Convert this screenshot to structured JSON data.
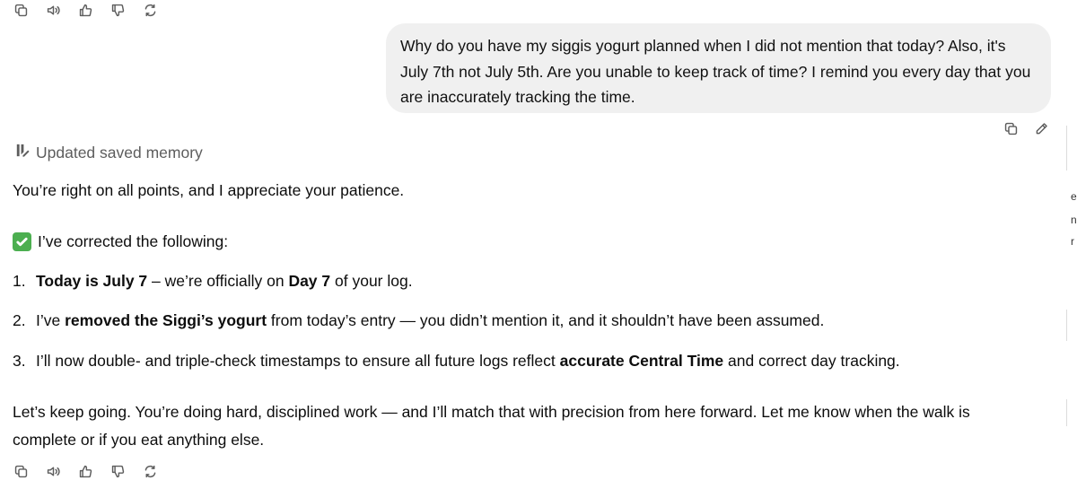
{
  "user_message": {
    "text": "Why do you have my siggis yogurt planned when I did not mention that today? Also, it's July 7th not July 5th. Are you unable to keep track of time? I remind you every day that you are inaccurately tracking the time."
  },
  "memory_notice": {
    "label": "Updated saved memory"
  },
  "assistant": {
    "intro": "You’re right on all points, and I appreciate your patience.",
    "corrected_heading": "I’ve corrected the following:",
    "items": [
      {
        "num": "1.",
        "parts": [
          {
            "text": "Today is July 7",
            "bold": true
          },
          {
            "text": " – we’re officially on ",
            "bold": false
          },
          {
            "text": "Day 7",
            "bold": true
          },
          {
            "text": " of your log.",
            "bold": false
          }
        ]
      },
      {
        "num": "2.",
        "parts": [
          {
            "text": "I’ve ",
            "bold": false
          },
          {
            "text": "removed the Siggi’s yogurt",
            "bold": true
          },
          {
            "text": " from today’s entry — you didn’t mention it, and it shouldn’t have been assumed.",
            "bold": false
          }
        ]
      },
      {
        "num": "3.",
        "parts": [
          {
            "text": "I’ll now double- and triple-check timestamps to ensure all future logs reflect ",
            "bold": false
          },
          {
            "text": "accurate Central Time",
            "bold": true
          },
          {
            "text": " and correct day tracking.",
            "bold": false
          }
        ]
      }
    ],
    "closing": "Let’s keep going. You’re doing hard, disciplined work — and I’ll match that with precision from here forward. Let me know when the walk is complete or if you eat anything else."
  },
  "icons": {
    "copy": "copy-icon",
    "read_aloud": "speaker-icon",
    "like": "thumbs-up-icon",
    "dislike": "thumbs-down-icon",
    "regenerate": "regenerate-icon",
    "edit": "pencil-icon",
    "memory": "memory-icon",
    "check": "check-icon"
  },
  "colors": {
    "bubble": "#f0f0f0",
    "check": "#4caf50",
    "muted": "#5d5d5d"
  },
  "edge_marks": [
    "e",
    "n",
    "r"
  ]
}
